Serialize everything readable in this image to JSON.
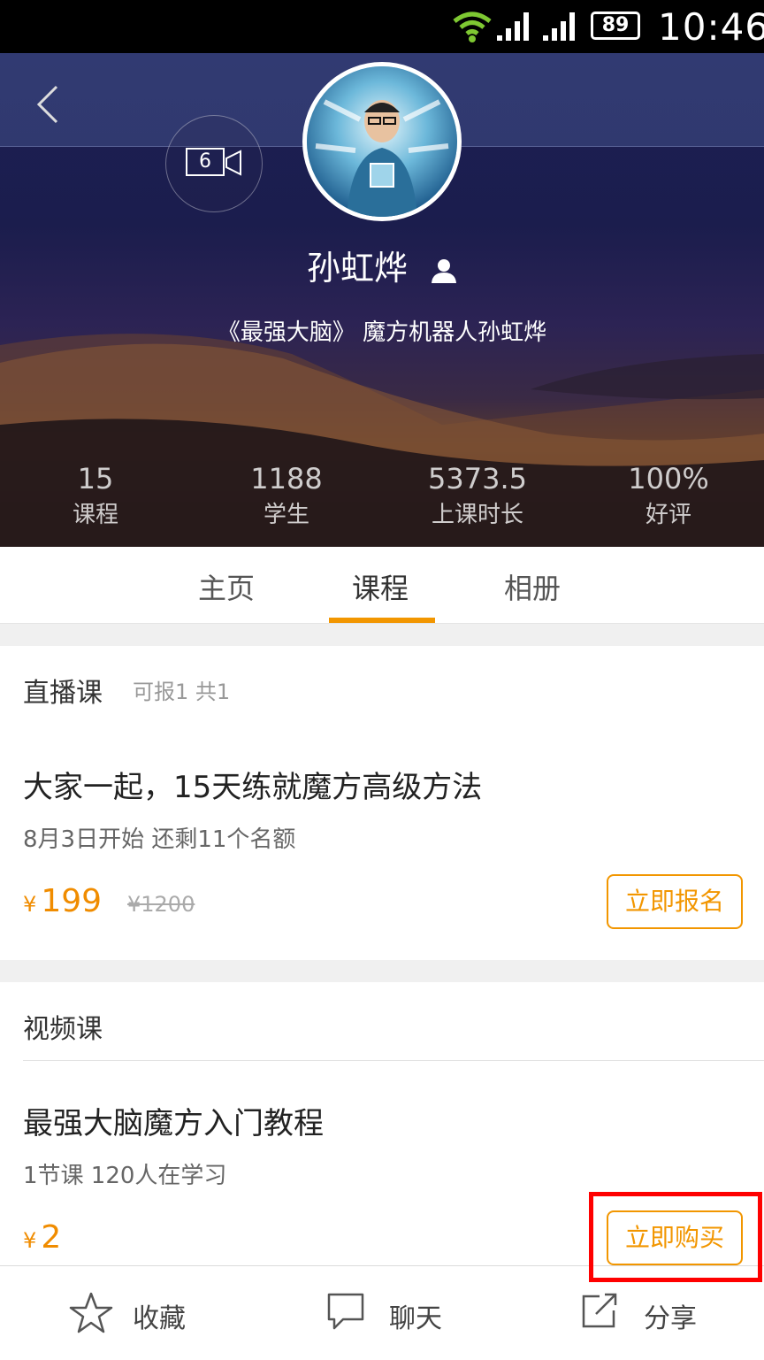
{
  "status_bar": {
    "battery": "89",
    "time": "10:46"
  },
  "header": {
    "video_count": "6",
    "teacher_name": "孙虹烨",
    "teacher_desc": "《最强大脑》 魔方机器人孙虹烨"
  },
  "stats": [
    {
      "value": "15",
      "label": "课程"
    },
    {
      "value": "1188",
      "label": "学生"
    },
    {
      "value": "5373.5",
      "label": "上课时长"
    },
    {
      "value": "100%",
      "label": "好评"
    }
  ],
  "tabs": [
    {
      "label": "主页"
    },
    {
      "label": "课程"
    },
    {
      "label": "相册"
    }
  ],
  "live_section": {
    "title": "直播课",
    "subtitle": "可报1 共1",
    "course": {
      "title": "大家一起，15天练就魔方高级方法",
      "meta": "8月3日开始  还剩11个名额",
      "currency": "¥",
      "price": "199",
      "original_price": "¥1200",
      "button": "立即报名"
    }
  },
  "video_section": {
    "title": "视频课",
    "course": {
      "title": "最强大脑魔方入门教程",
      "meta": "1节课 120人在学习",
      "currency": "¥",
      "price": "2",
      "button": "立即购买"
    }
  },
  "bottom_bar": {
    "favorite": "收藏",
    "chat": "聊天",
    "share": "分享"
  },
  "colors": {
    "accent": "#f29600",
    "highlight": "#ff0000"
  }
}
